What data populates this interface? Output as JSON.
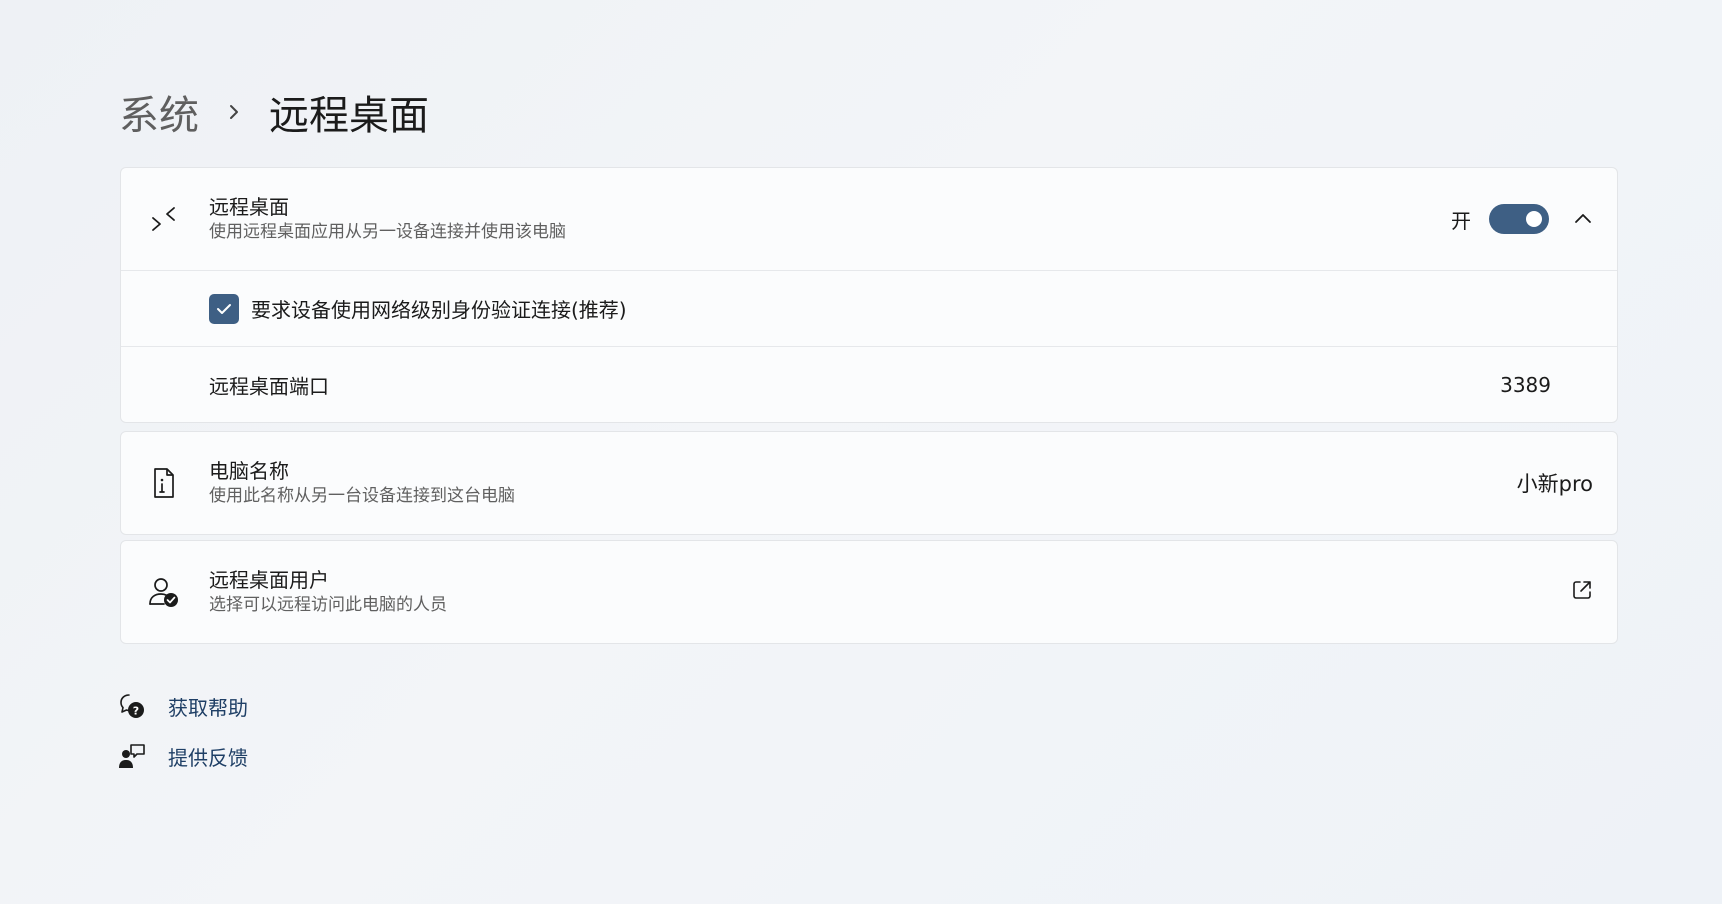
{
  "breadcrumb": {
    "parent": "系统",
    "current": "远程桌面"
  },
  "remote_desktop": {
    "title": "远程桌面",
    "subtitle": "使用远程桌面应用从另一设备连接并使用该电脑",
    "toggle_label": "开",
    "toggle_on": true,
    "nla_label": "要求设备使用网络级别身份验证连接(推荐)",
    "nla_checked": true,
    "port_label": "远程桌面端口",
    "port_value": "3389"
  },
  "pc_name": {
    "title": "电脑名称",
    "subtitle": "使用此名称从另一台设备连接到这台电脑",
    "value": "小新pro"
  },
  "remote_users": {
    "title": "远程桌面用户",
    "subtitle": "选择可以远程访问此电脑的人员"
  },
  "links": {
    "help": "获取帮助",
    "feedback": "提供反馈"
  },
  "colors": {
    "accent": "#3e5f84",
    "link": "#1f3f66"
  }
}
